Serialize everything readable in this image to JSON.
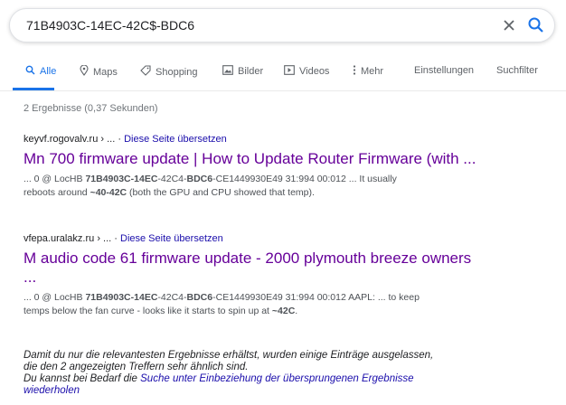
{
  "search": {
    "query": "71B4903C-14EC-42C$-BDC6"
  },
  "tabs": [
    {
      "label": "Alle",
      "icon": "search-icon",
      "active": true
    },
    {
      "label": "Maps",
      "icon": "map-pin-icon"
    },
    {
      "label": "Shopping",
      "icon": "tag-icon"
    },
    {
      "label": "Bilder",
      "icon": "image-icon"
    },
    {
      "label": "Videos",
      "icon": "video-icon"
    },
    {
      "label": "Mehr",
      "icon": "more-vert-icon"
    },
    {
      "label": "Einstellungen"
    },
    {
      "label": "Suchfilter"
    }
  ],
  "stats": "2 Ergebnisse (0,37 Sekunden)",
  "results": [
    {
      "url": "keyvf.rogovalv.ru › ... ·",
      "translate": "Diese Seite übersetzen",
      "title": "Mn 700 firmware update | How to Update Router Firmware (with ...",
      "snippet_line1": {
        "p1": "... 0 @ LocHB ",
        "b1": "71B4903C-14EC",
        "p2": "-42C4-",
        "b2": "BDC6",
        "p3": "-CE1449930E49 31:994 00:012 ... It usually"
      },
      "snippet_line2": {
        "p1": "reboots around ",
        "b1": "~40-42C",
        "p2": " (both the GPU and CPU showed that temp)."
      }
    },
    {
      "url": "vfepa.uralakz.ru › ... ·",
      "translate": "Diese Seite übersetzen",
      "title": "M audio code 61 firmware update - 2000 plymouth breeze owners",
      "title2": "...",
      "snippet_line1": {
        "p1": "... 0 @ LocHB ",
        "b1": "71B4903C-14EC",
        "p2": "-42C4-",
        "b2": "BDC6",
        "p3": "-CE1449930E49 31:994 00:012 AAPL: ... to keep"
      },
      "snippet_line2": {
        "p1": "temps below the fan curve - looks like it starts to spin up at ",
        "b1": "~42C",
        "p2": "."
      }
    }
  ],
  "notice": {
    "line1": "Damit du nur die relevantesten Ergebnisse erhältst, wurden einige Einträge ausgelassen,",
    "line2": "die den 2 angezeigten Treffern sehr ähnlich sind.",
    "line3_prefix": "Du kannst bei Bedarf die ",
    "link_part1": "Suche unter Einbeziehung der übersprungenen Ergebnisse",
    "link_part2": "wiederholen"
  },
  "colors": {
    "link": "#1a0dab",
    "visited": "#660099",
    "accent": "#1a73e8"
  }
}
